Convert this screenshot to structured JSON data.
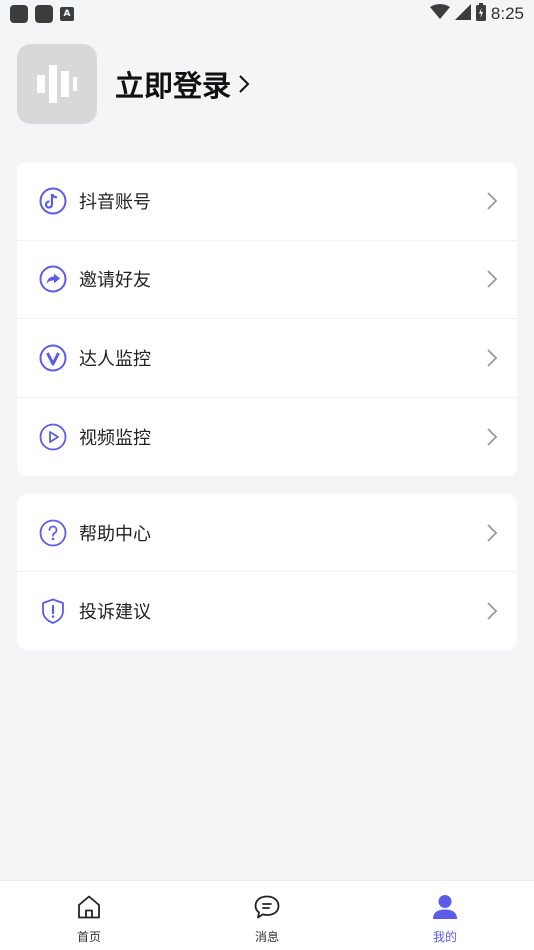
{
  "status_bar": {
    "time": "8:25",
    "left_icons": [
      "app-notification-icon",
      "app-notification-icon",
      "a-notification-icon"
    ],
    "right_icons": [
      "wifi-icon",
      "signal-icon",
      "battery-icon"
    ]
  },
  "header": {
    "login_label": "立即登录",
    "avatar_icon": "app-logo-icon"
  },
  "menu_group_1": [
    {
      "label": "抖音账号",
      "icon": "douyin-icon"
    },
    {
      "label": "邀请好友",
      "icon": "share-icon"
    },
    {
      "label": "达人监控",
      "icon": "v-badge-icon"
    },
    {
      "label": "视频监控",
      "icon": "play-icon"
    }
  ],
  "menu_group_2": [
    {
      "label": "帮助中心",
      "icon": "help-icon"
    },
    {
      "label": "投诉建议",
      "icon": "shield-alert-icon"
    }
  ],
  "bottom_nav": [
    {
      "label": "首页",
      "icon": "home-icon",
      "active": false
    },
    {
      "label": "消息",
      "icon": "message-icon",
      "active": false
    },
    {
      "label": "我的",
      "icon": "user-icon",
      "active": true
    }
  ],
  "colors": {
    "accent": "#5b5de8",
    "background": "#f4f5f7",
    "card": "#ffffff"
  }
}
